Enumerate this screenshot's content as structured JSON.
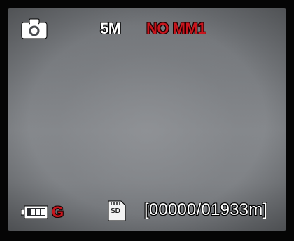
{
  "osd": {
    "resolution": "5M",
    "mode_label": "NO MM1",
    "gps_label": "G",
    "storage_label": "SD",
    "counter": "[00000/01933m]"
  },
  "icons": {
    "top_left": "camera-icon",
    "battery": "battery-icon",
    "storage": "sd-card-icon"
  },
  "battery_level": 0.75,
  "colors": {
    "osd_text": "#ffffff",
    "alert_text": "#c8161e",
    "bezel": "#050505",
    "screen": "#7f8286"
  }
}
